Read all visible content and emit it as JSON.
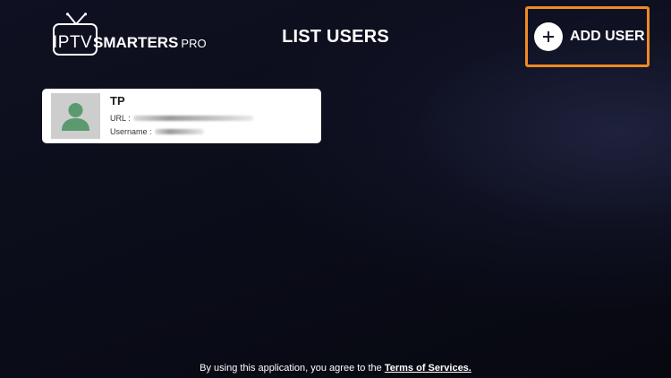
{
  "app": {
    "logo": {
      "iptv": "IPTV",
      "smarters": "SMARTERS",
      "pro": "PRO"
    }
  },
  "header": {
    "title": "LIST USERS",
    "add_user_label": "ADD USER"
  },
  "users": [
    {
      "name": "TP",
      "url_label": "URL :",
      "username_label": "Username :"
    }
  ],
  "footer": {
    "prefix": "By using this application, you agree to the",
    "link_text": "Terms of Services."
  },
  "colors": {
    "accent_border": "#f08a24",
    "avatar_bg": "#cdcdcd",
    "avatar_figure": "#5a9a6e"
  },
  "icons": {
    "add": "plus-icon",
    "avatar": "user-silhouette-icon",
    "logo": "tv-icon"
  }
}
